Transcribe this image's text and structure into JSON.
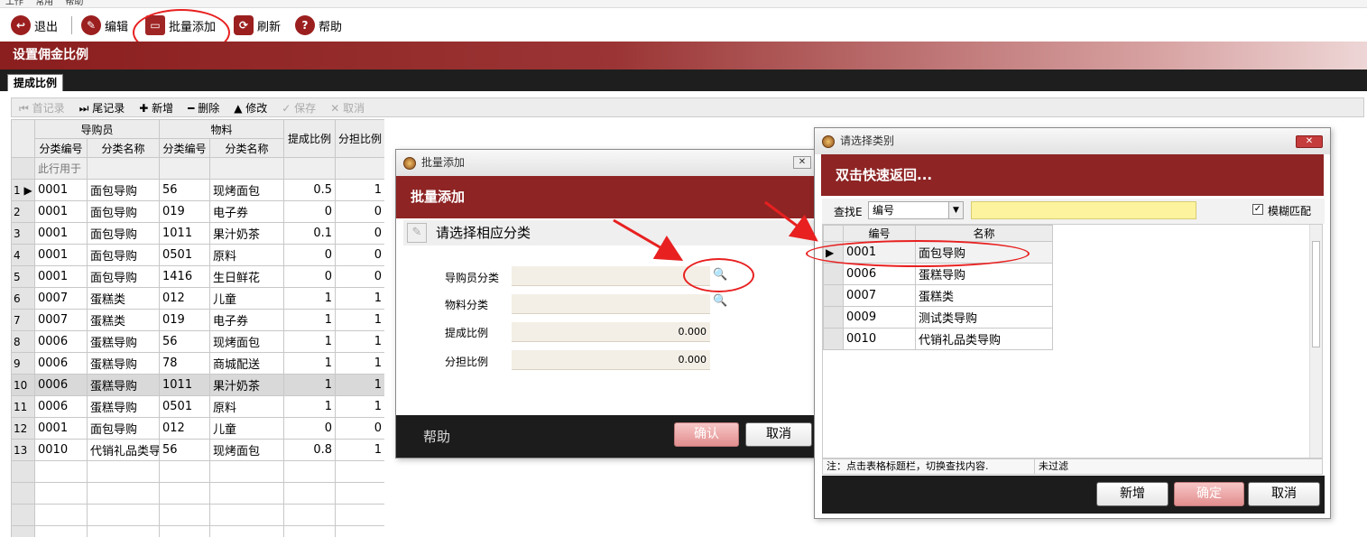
{
  "menubar": {
    "items": [
      "工作",
      "常用",
      "帮助"
    ]
  },
  "toolbar": {
    "buttons": [
      {
        "label": "退出",
        "icon": "exit-icon"
      },
      {
        "label": "编辑",
        "icon": "edit-icon"
      },
      {
        "label": "批量添加",
        "icon": "folder-icon"
      },
      {
        "label": "刷新",
        "icon": "refresh-icon"
      },
      {
        "label": "帮助",
        "icon": "help-icon"
      }
    ]
  },
  "page": {
    "title": "设置佣金比例",
    "tab": "提成比例"
  },
  "subtoolbar": {
    "items": [
      {
        "label": "首记录",
        "enabled": false
      },
      {
        "label": "尾记录",
        "enabled": true
      },
      {
        "label": "新增",
        "enabled": true
      },
      {
        "label": "删除",
        "enabled": true
      },
      {
        "label": "修改",
        "enabled": true
      },
      {
        "label": "保存",
        "enabled": false
      },
      {
        "label": "取消",
        "enabled": false
      }
    ]
  },
  "grid": {
    "group_headers": [
      "导购员",
      "物料",
      "提成比例",
      "分担比例"
    ],
    "columns": [
      "分类编号",
      "分类名称",
      "分类编号",
      "分类名称"
    ],
    "filter_hint": "此行用于",
    "rows": [
      {
        "n": "1",
        "c1": "0001",
        "c2": "面包导购",
        "c3": "56",
        "c4": "现烤面包",
        "r1": "0.5",
        "r2": "1"
      },
      {
        "n": "2",
        "c1": "0001",
        "c2": "面包导购",
        "c3": "019",
        "c4": "电子券",
        "r1": "0",
        "r2": "0"
      },
      {
        "n": "3",
        "c1": "0001",
        "c2": "面包导购",
        "c3": "1011",
        "c4": "果汁奶茶",
        "r1": "0.1",
        "r2": "0"
      },
      {
        "n": "4",
        "c1": "0001",
        "c2": "面包导购",
        "c3": "0501",
        "c4": "原料",
        "r1": "0",
        "r2": "0"
      },
      {
        "n": "5",
        "c1": "0001",
        "c2": "面包导购",
        "c3": "1416",
        "c4": "生日鲜花",
        "r1": "0",
        "r2": "0"
      },
      {
        "n": "6",
        "c1": "0007",
        "c2": "蛋糕类",
        "c3": "012",
        "c4": "儿童",
        "r1": "1",
        "r2": "1"
      },
      {
        "n": "7",
        "c1": "0007",
        "c2": "蛋糕类",
        "c3": "019",
        "c4": "电子券",
        "r1": "1",
        "r2": "1"
      },
      {
        "n": "8",
        "c1": "0006",
        "c2": "蛋糕导购",
        "c3": "56",
        "c4": "现烤面包",
        "r1": "1",
        "r2": "1"
      },
      {
        "n": "9",
        "c1": "0006",
        "c2": "蛋糕导购",
        "c3": "78",
        "c4": "商城配送",
        "r1": "1",
        "r2": "1"
      },
      {
        "n": "10",
        "c1": "0006",
        "c2": "蛋糕导购",
        "c3": "1011",
        "c4": "果汁奶茶",
        "r1": "1",
        "r2": "1"
      },
      {
        "n": "11",
        "c1": "0006",
        "c2": "蛋糕导购",
        "c3": "0501",
        "c4": "原料",
        "r1": "1",
        "r2": "1"
      },
      {
        "n": "12",
        "c1": "0001",
        "c2": "面包导购",
        "c3": "012",
        "c4": "儿童",
        "r1": "0",
        "r2": "0"
      },
      {
        "n": "13",
        "c1": "0010",
        "c2": "代销礼品类导",
        "c3": "56",
        "c4": "现烤面包",
        "r1": "0.8",
        "r2": "1"
      }
    ]
  },
  "batch_dialog": {
    "window_title": "批量添加",
    "header": "批量添加",
    "prompt": "请选择相应分类",
    "fields": [
      {
        "label": "导购员分类",
        "value": ""
      },
      {
        "label": "物料分类",
        "value": ""
      },
      {
        "label": "提成比例",
        "value": "0.000"
      },
      {
        "label": "分担比例",
        "value": "0.000"
      }
    ],
    "footer_help": "帮助",
    "confirm": "确认",
    "cancel": "取消"
  },
  "select_dialog": {
    "window_title": "请选择类别",
    "header": "双击快速返回...",
    "search_label": "查找E",
    "search_field_option": "编号",
    "search_value": "",
    "fuzzy_label": "模糊匹配",
    "fuzzy_checked": true,
    "columns": [
      "编号",
      "名称"
    ],
    "rows": [
      {
        "code": "0001",
        "name": "面包导购"
      },
      {
        "code": "0006",
        "name": "蛋糕导购"
      },
      {
        "code": "0007",
        "name": "蛋糕类"
      },
      {
        "code": "0009",
        "name": "测试类导购"
      },
      {
        "code": "0010",
        "name": "代销礼品类导购"
      }
    ],
    "status_note": "注：点击表格标题栏，切换查找内容.",
    "status_filter": "未过滤",
    "add": "新增",
    "confirm": "确定",
    "cancel": "取消"
  },
  "colors": {
    "brand": "#8e2424",
    "callout": "#e82020"
  }
}
